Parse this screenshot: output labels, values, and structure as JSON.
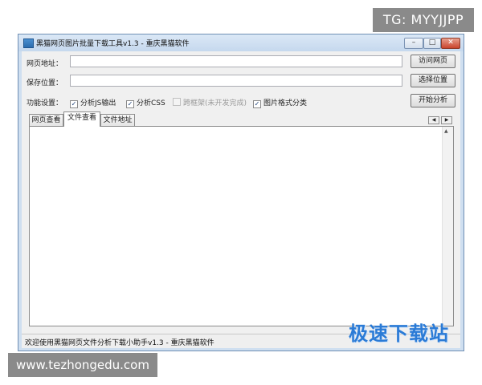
{
  "overlay": {
    "tg_badge": "TG: MYYJJPP",
    "site_left": "www.tezhongedu.com",
    "site_right": "极速下载站"
  },
  "window": {
    "title": "黑猫网页图片批量下载工具v1.3 - 重庆黑猫软件",
    "controls": {
      "minimize": "–",
      "maximize": "□",
      "close": "✕"
    }
  },
  "form": {
    "url_label": "网页地址：",
    "url_value": "",
    "save_label": "保存位置：",
    "save_value": "",
    "visit_button": "访问网页",
    "choose_button": "选择位置",
    "start_button": "开始分析",
    "options_label": "功能设置：",
    "options": [
      {
        "label": "分析JS输出",
        "checked": true
      },
      {
        "label": "分析CSS",
        "checked": true
      },
      {
        "label": "跨框架(未开发完成)",
        "checked": false,
        "disabled": true
      },
      {
        "label": "图片格式分类",
        "checked": true
      }
    ]
  },
  "tabs": [
    {
      "label": "网页查看"
    },
    {
      "label": "文件查看",
      "active": true
    },
    {
      "label": "文件地址"
    }
  ],
  "tab_scroll": {
    "prev": "◀",
    "next": "▶"
  },
  "status": {
    "text": "欢迎使用黑猫网页文件分析下载小助手v1.3 - 重庆黑猫软件"
  }
}
